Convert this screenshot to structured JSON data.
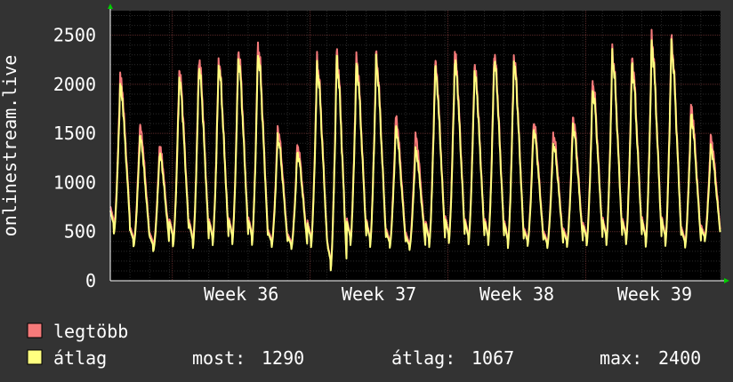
{
  "chart_data": {
    "type": "line",
    "ylabel": "onlinestream.live",
    "ylim": [
      0,
      2750
    ],
    "yticks": [
      0,
      500,
      1000,
      1500,
      2000,
      2500
    ],
    "xticks": [
      "Week 36",
      "Week 37",
      "Week 38",
      "Week 39"
    ],
    "grid": true,
    "colors": {
      "background": "#333333",
      "plot": "#000000",
      "grid_major": "#5a2a2a",
      "grid_minor": "#2a2a2a",
      "axis_arrow": "#00cc00"
    },
    "days": 31,
    "series": [
      {
        "name": "legtöbb",
        "color": "#f57a7a",
        "daily_peaks": [
          2090,
          1580,
          1380,
          2150,
          2280,
          2250,
          2360,
          2420,
          1560,
          1390,
          2250,
          2330,
          2270,
          2290,
          1670,
          1480,
          2230,
          2330,
          2200,
          2330,
          2290,
          1630,
          1500,
          1670,
          2040,
          2340,
          2270,
          2470,
          2450,
          1780,
          1460
        ],
        "daily_troughs": [
          520,
          370,
          330,
          370,
          330,
          360,
          370,
          360,
          350,
          330,
          340,
          90,
          360,
          340,
          340,
          320,
          340,
          380,
          370,
          360,
          330,
          360,
          340,
          350,
          360,
          360,
          370,
          340,
          350,
          340,
          410
        ]
      },
      {
        "name": "átlag",
        "color": "#ffff80",
        "daily_peaks": [
          2000,
          1470,
          1300,
          2060,
          2190,
          2200,
          2270,
          2330,
          1470,
          1310,
          2180,
          2250,
          2200,
          2230,
          1560,
          1340,
          2160,
          2250,
          2130,
          2260,
          2230,
          1550,
          1410,
          1580,
          1960,
          2290,
          2190,
          2410,
          2390,
          1690,
          1360
        ],
        "daily_troughs": [
          480,
          350,
          300,
          350,
          310,
          340,
          350,
          340,
          330,
          310,
          320,
          80,
          340,
          320,
          320,
          300,
          320,
          360,
          350,
          340,
          310,
          340,
          320,
          330,
          340,
          340,
          350,
          320,
          330,
          320,
          390
        ]
      }
    ]
  },
  "stats": {
    "now_label": "most:",
    "now_value": "1290",
    "avg_label": "átlag:",
    "avg_value": "1067",
    "max_label": "max:",
    "max_value": "2400"
  }
}
